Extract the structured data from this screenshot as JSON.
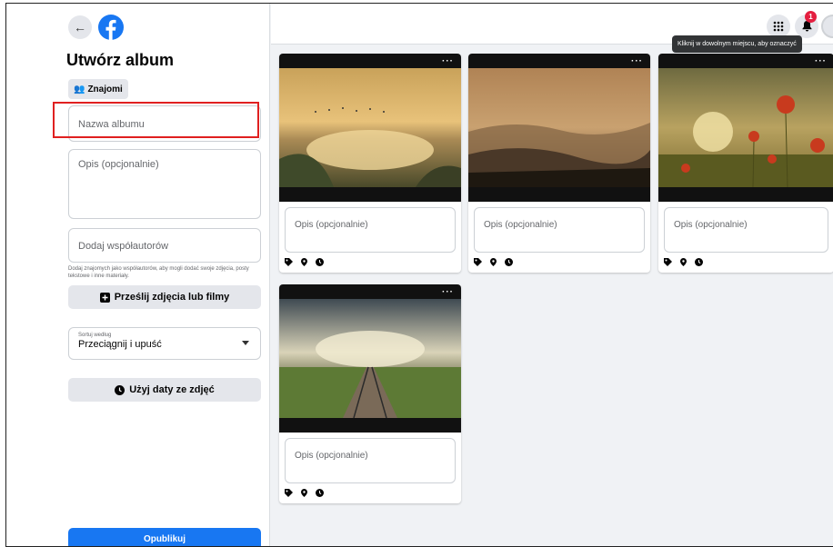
{
  "left_panel": {
    "title": "Utwórz album",
    "audience_label": "Znajomi",
    "name_placeholder": "Nazwa albumu",
    "desc_placeholder": "Opis (opcjonalnie)",
    "coauthors_placeholder": "Dodaj współautorów",
    "coauthors_hint": "Dodaj znajomych jako współautorów, aby mogli dodać swoje zdjęcia, posty tekstowe i inne materiały.",
    "upload_label": "Prześlij zdjęcia lub filmy",
    "sort_label": "Sortuj według",
    "sort_value": "Przeciągnij i upuść",
    "use_dates_label": "Użyj daty ze zdjęć",
    "publish_label": "Opublikuj"
  },
  "topbar": {
    "notification_count": "1",
    "tooltip": "Kliknij w dowolnym miejscu, aby oznaczyć"
  },
  "cards": [
    {
      "desc_placeholder": "Opis (opcjonalnie)",
      "menu": "···"
    },
    {
      "desc_placeholder": "Opis (opcjonalnie)",
      "menu": "···"
    },
    {
      "desc_placeholder": "Opis (opcjonalnie)",
      "menu": "···"
    },
    {
      "desc_placeholder": "Opis (opcjonalnie)",
      "menu": "···"
    }
  ],
  "colors": {
    "accent": "#1877f2",
    "highlight": "#e02020",
    "badge": "#e41e3f"
  }
}
